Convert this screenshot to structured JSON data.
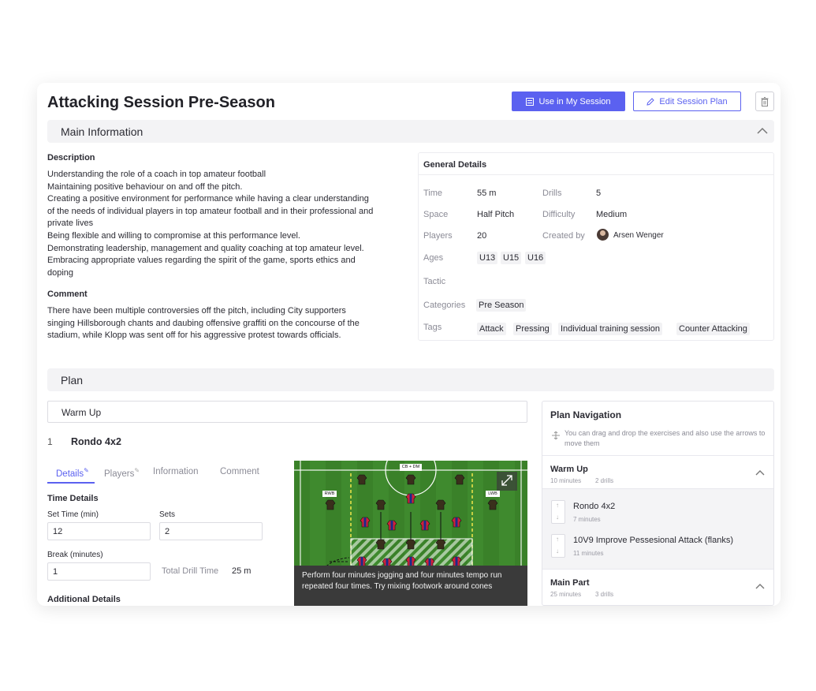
{
  "header": {
    "title": "Attacking Session Pre-Season",
    "use_button": "Use in My Session",
    "edit_button": "Edit Session Plan"
  },
  "main_info": {
    "section_title": "Main Information",
    "description_label": "Description",
    "description_lines": [
      "Understanding the role of a coach in top amateur football",
      "Maintaining positive behaviour on and off the pitch.",
      "Creating a positive environment for performance while having a clear understanding",
      "of the needs of individual players in top amateur football and in their professional and",
      "private lives",
      "Being flexible and willing to compromise at this performance level.",
      "Demonstrating leadership, management and quality coaching at top amateur level.",
      "Embracing appropriate values regarding the spirit of the game, sports ethics and",
      "doping"
    ],
    "comment_label": "Comment",
    "comment_lines": [
      "There have been multiple controversies off the pitch, including City supporters",
      "singing Hillsborough chants and daubing offensive graffiti on the concourse of the",
      "stadium, while Klopp was sent off for his aggressive protest towards officials."
    ]
  },
  "general_details": {
    "title": "General Details",
    "time_label": "Time",
    "time_value": "55 m",
    "drills_label": "Drills",
    "drills_value": "5",
    "space_label": "Space",
    "space_value": "Half Pitch",
    "difficulty_label": "Difficulty",
    "difficulty_value": "Medium",
    "players_label": "Players",
    "players_value": "20",
    "created_label": "Created by",
    "created_value": "Arsen Wenger",
    "ages_label": "Ages",
    "ages": [
      "U13",
      "U15",
      "U16"
    ],
    "tactic_label": "Tactic",
    "categories_label": "Categories",
    "categories": [
      "Pre Season"
    ],
    "tags_label": "Tags",
    "tags": [
      "Attack",
      "Pressing",
      "Individual training session",
      "Counter Attacking"
    ]
  },
  "plan": {
    "section_title": "Plan",
    "group_title": "Warm Up",
    "drill_number": "1",
    "drill_title": "Rondo 4x2",
    "tabs": [
      "Details",
      "Players",
      "Information",
      "Comment"
    ],
    "time_details_label": "Time Details",
    "set_time_label": "Set Time (min)",
    "set_time_value": "12",
    "sets_label": "Sets",
    "sets_value": "2",
    "break_label": "Break (minutes)",
    "break_value": "1",
    "total_label": "Total Drill Time",
    "total_value": "25 m",
    "additional_label": "Additional Details",
    "pitch_labels": {
      "top": "CB + DM",
      "left": "RWB",
      "right": "LWB"
    },
    "caption_lines": [
      "Perform four minutes jogging and four minutes tempo run",
      "repeated four times. Try mixing footwork around cones"
    ]
  },
  "plan_navigation": {
    "title": "Plan Navigation",
    "hint": "You can drag and drop the exercises and also use the arrows to move them",
    "groups": [
      {
        "title": "Warm Up",
        "minutes": "10 minutes",
        "drills": "2 drills"
      },
      {
        "title": "Main Part",
        "minutes": "25 minutes",
        "drills": "3 drills"
      }
    ],
    "drills": [
      {
        "title": "Rondo 4x2",
        "minutes": "7 minutes"
      },
      {
        "title": "10V9 Improve Pessesional Attack (flanks)",
        "minutes": "11 minutes"
      }
    ]
  },
  "colors": {
    "accent": "#5b61f0",
    "pitch": "#3f8a2e",
    "team_red": "#d0213a",
    "team_dark": "#3a2f1c"
  }
}
